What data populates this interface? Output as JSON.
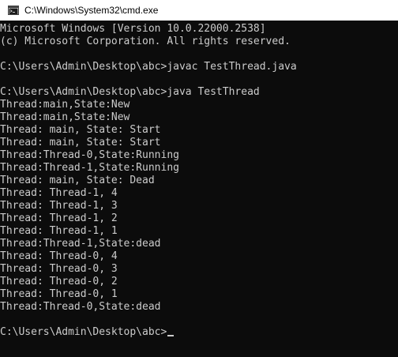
{
  "window": {
    "title": "C:\\Windows\\System32\\cmd.exe",
    "icon": "cmd-icon"
  },
  "console": {
    "lines": [
      "Microsoft Windows [Version 10.0.22000.2538]",
      "(c) Microsoft Corporation. All rights reserved.",
      "",
      "C:\\Users\\Admin\\Desktop\\abc>javac TestThread.java",
      "",
      "C:\\Users\\Admin\\Desktop\\abc>java TestThread",
      "Thread:main,State:New",
      "Thread:main,State:New",
      "Thread: main, State: Start",
      "Thread: main, State: Start",
      "Thread:Thread-0,State:Running",
      "Thread:Thread-1,State:Running",
      "Thread: main, State: Dead",
      "Thread: Thread-1, 4",
      "Thread: Thread-1, 3",
      "Thread: Thread-1, 2",
      "Thread: Thread-1, 1",
      "Thread:Thread-1,State:dead",
      "Thread: Thread-0, 4",
      "Thread: Thread-0, 3",
      "Thread: Thread-0, 2",
      "Thread: Thread-0, 1",
      "Thread:Thread-0,State:dead",
      ""
    ],
    "prompt": "C:\\Users\\Admin\\Desktop\\abc>"
  }
}
